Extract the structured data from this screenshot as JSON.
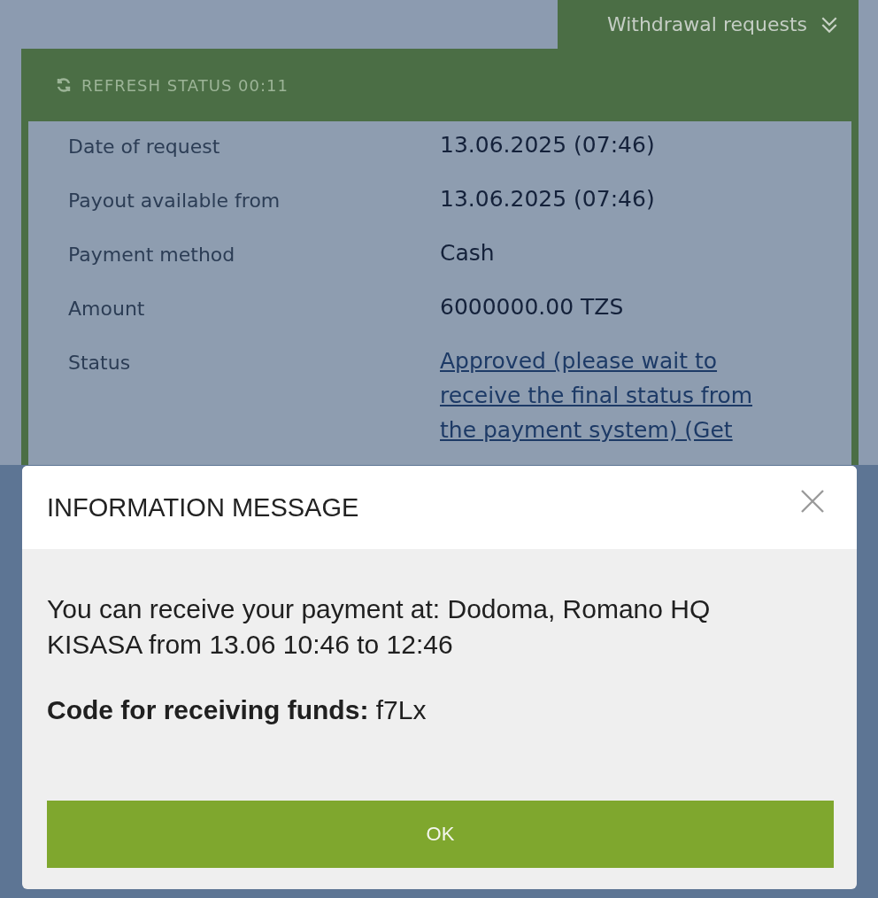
{
  "header_tab": {
    "label": "Withdrawal requests",
    "expanded": true
  },
  "refresh": {
    "label": "REFRESH STATUS 00:11",
    "disabled": true
  },
  "details": [
    {
      "label": "Date of request",
      "value": "13.06.2025 (07:46)",
      "kind": "text"
    },
    {
      "label": "Payout available from",
      "value": "13.06.2025 (07:46)",
      "kind": "text"
    },
    {
      "label": "Payment method",
      "value": "Cash",
      "kind": "text"
    },
    {
      "label": "Amount",
      "value": "6000000.00 TZS",
      "kind": "text"
    },
    {
      "label": "Status",
      "value": "Approved (please wait to receive the final status from the payment system) (Get",
      "kind": "link"
    }
  ],
  "dialog": {
    "title": "INFORMATION MESSAGE",
    "message": "You can receive your payment at: Dodoma, Romano HQ KISASA from 13.06 10:46 to 12:46",
    "code": "**Code for receiving funds:** f7Lx",
    "button": "OK"
  }
}
